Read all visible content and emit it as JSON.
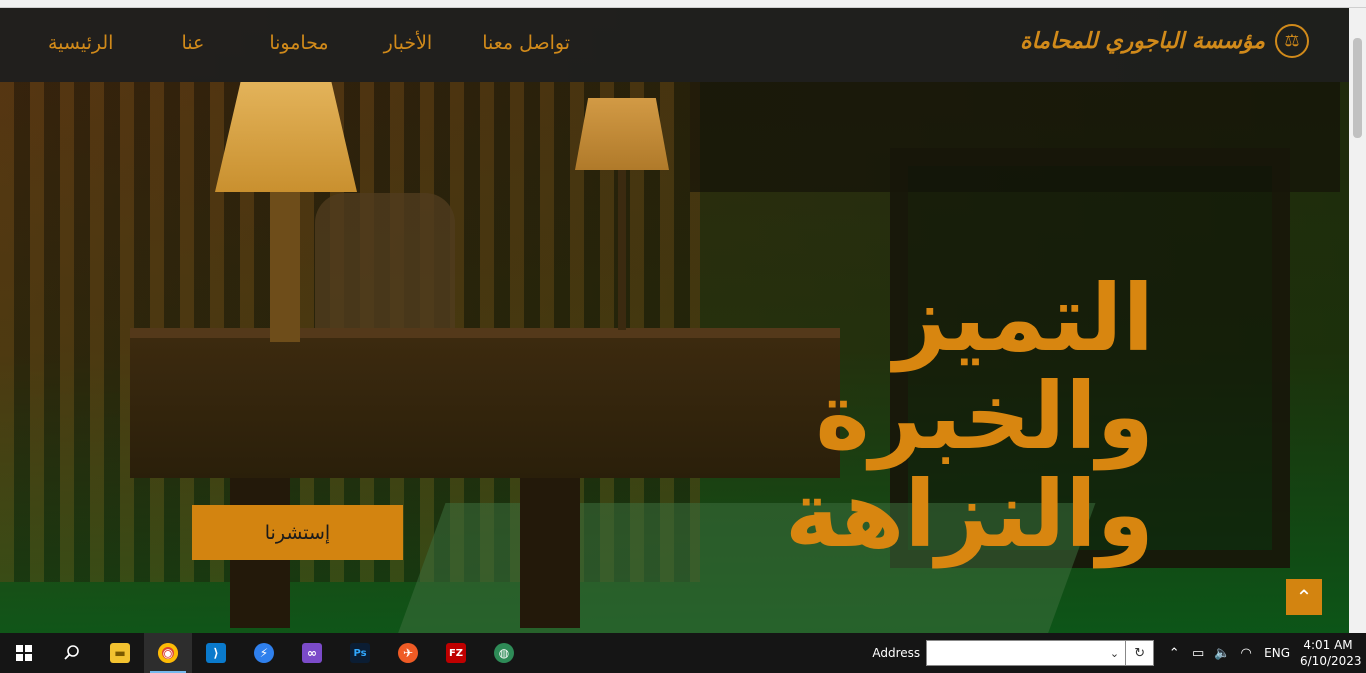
{
  "brand": {
    "name": "مؤسسة الباجوري للمحاماة",
    "icon": "scales-icon"
  },
  "nav": {
    "items": [
      {
        "label": "الرئيسية"
      },
      {
        "label": "عنا"
      },
      {
        "label": "محامونا"
      },
      {
        "label": "الأخبار"
      },
      {
        "label": "تواصل معنا"
      }
    ]
  },
  "hero": {
    "headline": [
      "التميز",
      "والخبرة",
      "والنزاهة"
    ],
    "cta_label": "إستشرنا"
  },
  "back_to_top": {
    "icon": "chevron-up-icon"
  },
  "colors": {
    "accent": "#d38410",
    "nav_bg": "#1e1e1e",
    "taskbar_bg": "#151515"
  },
  "taskbar": {
    "apps": [
      {
        "name": "file-explorer-icon",
        "glyph": "▬"
      },
      {
        "name": "chrome-icon",
        "glyph": "◉"
      },
      {
        "name": "vscode-icon",
        "glyph": "⟩"
      },
      {
        "name": "app-blue-icon",
        "glyph": "⚡"
      },
      {
        "name": "visual-studio-icon",
        "glyph": "∞"
      },
      {
        "name": "photoshop-icon",
        "glyph": "Ps"
      },
      {
        "name": "postman-icon",
        "glyph": "✈"
      },
      {
        "name": "filezilla-icon",
        "glyph": "FZ"
      },
      {
        "name": "network-globe-icon",
        "glyph": "◍"
      }
    ],
    "address_label": "Address",
    "language": "ENG",
    "time": "4:01 AM",
    "date": "6/10/2023"
  }
}
